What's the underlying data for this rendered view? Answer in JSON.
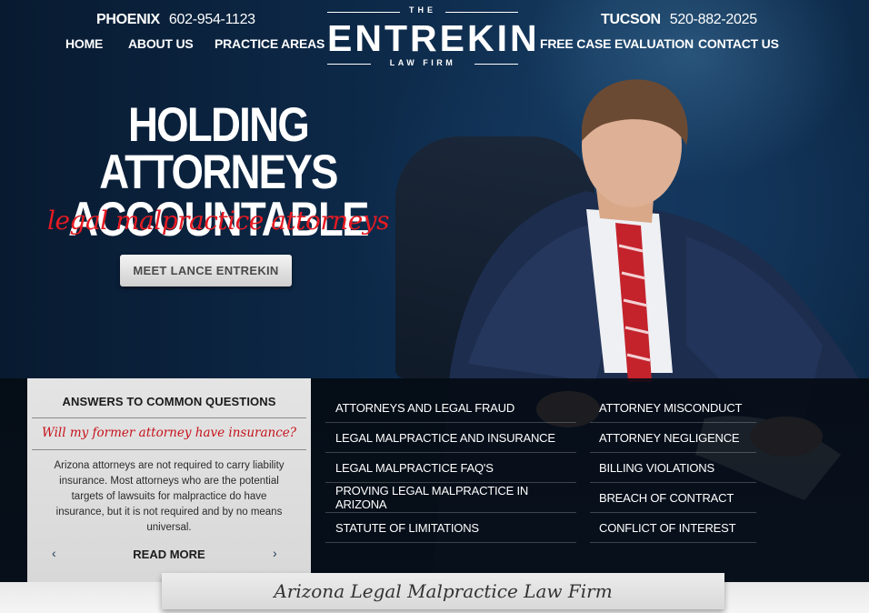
{
  "header": {
    "phone_left": {
      "city": "PHOENIX",
      "number": "602-954-1123"
    },
    "phone_right": {
      "city": "TUCSON",
      "number": "520-882-2025"
    },
    "nav_left": [
      "HOME",
      "ABOUT US",
      "PRACTICE AREAS"
    ],
    "nav_right": [
      "FREE CASE EVALUATION",
      "CONTACT US"
    ],
    "logo": {
      "top": "THE",
      "name": "ENTREKIN",
      "sub": "LAW FIRM"
    }
  },
  "hero": {
    "headline_line1": "HOLDING ATTORNEYS",
    "headline_line2": "ACCOUNTABLE",
    "tagline": "legal malpractice attorneys",
    "button": "MEET LANCE ENTREKIN"
  },
  "faq": {
    "title": "ANSWERS TO COMMON QUESTIONS",
    "question": "Will my former attorney have insurance?",
    "answer": "Arizona attorneys are not required to carry liability insurance. Most attorneys who are the potential targets of lawsuits for malpractice do have insurance, but it is not required and by no means universal.",
    "prev": "‹",
    "next": "›",
    "read_more": "READ MORE"
  },
  "topics_left": [
    "ATTORNEYS AND LEGAL FRAUD",
    "LEGAL MALPRACTICE AND INSURANCE",
    "LEGAL MALPRACTICE FAQ'S",
    "PROVING LEGAL MALPRACTICE IN ARIZONA",
    "STATUTE OF LIMITATIONS"
  ],
  "topics_right": [
    "ATTORNEY MISCONDUCT",
    "ATTORNEY NEGLIGENCE",
    "BILLING VIOLATIONS",
    "BREACH OF CONTRACT",
    "CONFLICT OF INTEREST"
  ],
  "banner": "Arizona Legal Malpractice Law Firm",
  "colors": {
    "accent_red": "#e51b23",
    "navy": "#0c2036"
  }
}
